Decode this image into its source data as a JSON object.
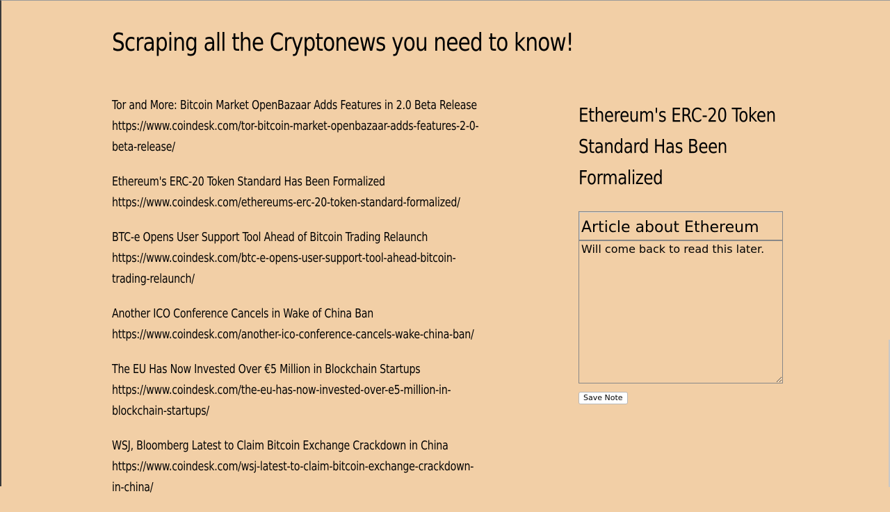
{
  "page": {
    "title": "Scraping all the Cryptonews you need to know!"
  },
  "articles": [
    {
      "title": "Tor and More: Bitcoin Market OpenBazaar Adds Features in 2.0 Beta Release",
      "link_line1": "https://www.coindesk.com/tor-bitcoin-market-openbazaar-adds-features-2-0-",
      "link_line2": "beta-release/"
    },
    {
      "title": "Ethereum's ERC-20 Token Standard Has Been Formalized",
      "link_line1": "https://www.coindesk.com/ethereums-erc-20-token-standard-formalized/"
    },
    {
      "title": "BTC-e Opens User Support Tool Ahead of Bitcoin Trading Relaunch",
      "link_line1": "https://www.coindesk.com/btc-e-opens-user-support-tool-ahead-bitcoin-",
      "link_line2": "trading-relaunch/"
    },
    {
      "title": "Another ICO Conference Cancels in Wake of China Ban",
      "link_line1": "https://www.coindesk.com/another-ico-conference-cancels-wake-china-ban/"
    },
    {
      "title": "The EU Has Now Invested Over €5 Million in Blockchain Startups",
      "link_line1": "https://www.coindesk.com/the-eu-has-now-invested-over-e5-million-in-",
      "link_line2": "blockchain-startups/"
    },
    {
      "title": "WSJ, Bloomberg Latest to Claim Bitcoin Exchange Crackdown in China",
      "link_line1": "https://www.coindesk.com/wsj-latest-to-claim-bitcoin-exchange-crackdown-",
      "link_line2": "in-china/"
    }
  ],
  "note": {
    "selected_article_title": "Ethereum's ERC-20 Token Standard Has Been Formalized",
    "title_value": "Article about Ethereum",
    "body_value": "Will come back to read this later.",
    "save_label": "Save Note"
  },
  "colors": {
    "background": "#f2cfa6",
    "text": "#000000"
  }
}
